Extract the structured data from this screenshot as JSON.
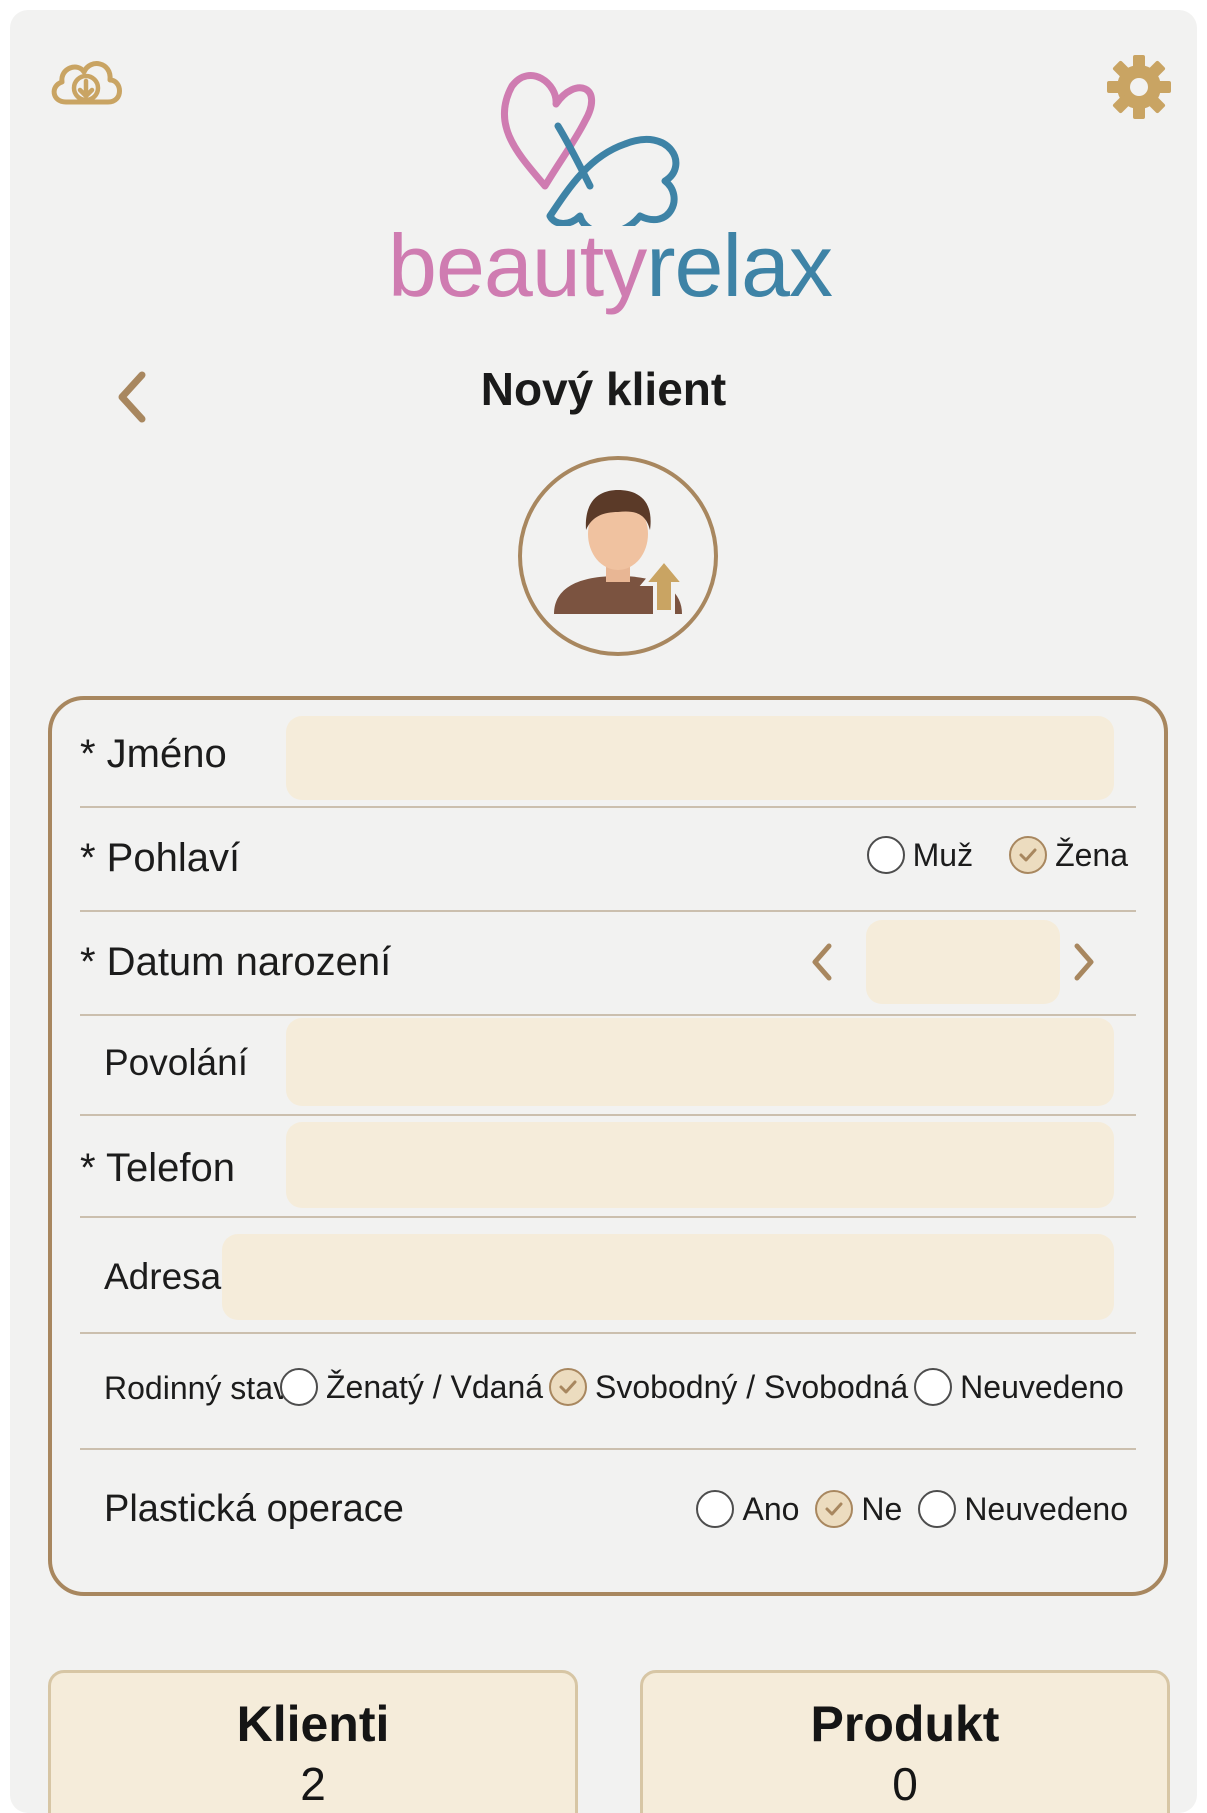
{
  "header": {
    "brand_part1": "beauty",
    "brand_part2": "relax",
    "cloud_icon": "cloud-download-icon",
    "settings_icon": "gear-icon"
  },
  "page": {
    "title": "Nový klient",
    "back_icon": "chevron-left-icon",
    "avatar_icon": "avatar-upload-icon"
  },
  "form": {
    "name": {
      "label": "* Jméno",
      "value": ""
    },
    "gender": {
      "label": "* Pohlaví",
      "options": [
        "Muž",
        "Žena"
      ],
      "selected": "Žena"
    },
    "birthdate": {
      "label": "* Datum narození",
      "value": ""
    },
    "occupation": {
      "label": "Povolání",
      "value": ""
    },
    "phone": {
      "label": "* Telefon",
      "value": ""
    },
    "address": {
      "label": "Adresa",
      "value": ""
    },
    "marital": {
      "label": "Rodinný stav",
      "options": [
        "Ženatý / Vdaná",
        "Svobodný / Svobodná",
        "Neuvedeno"
      ],
      "selected": "Svobodný / Svobodná"
    },
    "plastic": {
      "label": "Plastická operace",
      "options": [
        "Ano",
        "Ne",
        "Neuvedeno"
      ],
      "selected": "Ne"
    }
  },
  "bottom": {
    "clients": {
      "label": "Klienti",
      "count": "2"
    },
    "products": {
      "label": "Produkt",
      "count": "0"
    }
  },
  "colors": {
    "accent": "#a8875f",
    "input_bg": "#f5ecda",
    "logo_pink": "#cf7cb1",
    "logo_blue": "#3e83a6"
  }
}
